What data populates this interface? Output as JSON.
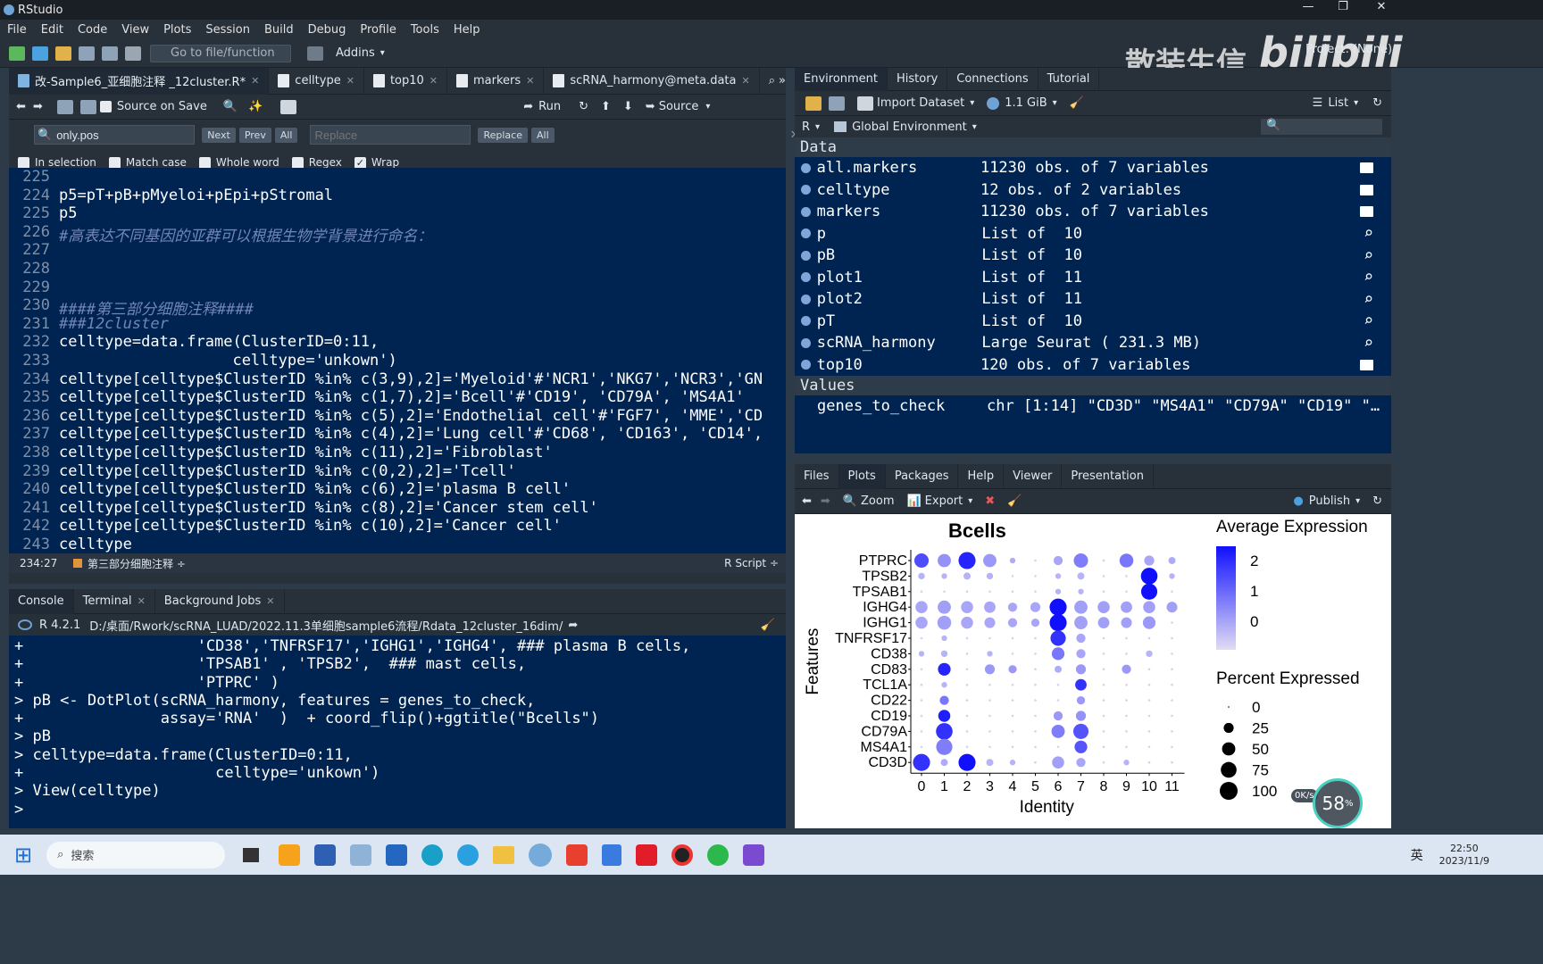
{
  "window": {
    "title": "RStudio"
  },
  "menu": [
    "File",
    "Edit",
    "Code",
    "View",
    "Plots",
    "Session",
    "Build",
    "Debug",
    "Profile",
    "Tools",
    "Help"
  ],
  "toolbar": {
    "goto_placeholder": "Go to file/function",
    "addins": "Addins",
    "project": "Project: (None)"
  },
  "watermark": {
    "text": "散装生信",
    "logo": "bilibili"
  },
  "editor": {
    "tabs": [
      {
        "label": "改-Sample6_亚细胞注释 _12cluster.R*",
        "active": true
      },
      {
        "label": "celltype",
        "active": false
      },
      {
        "label": "top10",
        "active": false
      },
      {
        "label": "markers",
        "active": false
      },
      {
        "label": "scRNA_harmony@meta.data",
        "active": false
      }
    ],
    "toolbar": {
      "source_on_save": "Source on Save",
      "run": "Run",
      "source": "Source"
    },
    "find": {
      "value": "only.pos",
      "next": "Next",
      "prev": "Prev",
      "all": "All",
      "replace_placeholder": "Replace",
      "replace": "Replace",
      "replace_all": "All"
    },
    "options": {
      "in_selection": "In selection",
      "match_case": "Match case",
      "whole_word": "Whole word",
      "regex": "Regex",
      "wrap": "Wrap"
    },
    "status": {
      "position": "234:27",
      "section": "第三部分细胞注释 ÷",
      "filetype": "R Script ÷"
    },
    "lines": [
      {
        "n": "225",
        "code": ""
      },
      {
        "n": "224",
        "code": "p5=pT+pB+pMyeloi+pEpi+pStromal"
      },
      {
        "n": "225",
        "code": "p5"
      },
      {
        "n": "226",
        "code": "#高表达不同基因的亚群可以根据生物学背景进行命名：",
        "comment": true
      },
      {
        "n": "227",
        "code": ""
      },
      {
        "n": "228",
        "code": ""
      },
      {
        "n": "229",
        "code": ""
      },
      {
        "n": "230",
        "code": "####第三部分细胞注释####",
        "comment": true
      },
      {
        "n": "231",
        "code": "###12cluster",
        "comment": true
      },
      {
        "n": "232",
        "code": "celltype=data.frame(ClusterID=0:11,"
      },
      {
        "n": "233",
        "code": "                   celltype='unkown')"
      },
      {
        "n": "234",
        "code": "celltype[celltype$ClusterID %in% c(3,9),2]='Myeloid'#'NCR1','NKG7','NCR3','GN"
      },
      {
        "n": "235",
        "code": "celltype[celltype$ClusterID %in% c(1,7),2]='Bcell'#'CD19', 'CD79A', 'MS4A1'"
      },
      {
        "n": "236",
        "code": "celltype[celltype$ClusterID %in% c(5),2]='Endothelial cell'#'FGF7', 'MME','CD"
      },
      {
        "n": "237",
        "code": "celltype[celltype$ClusterID %in% c(4),2]='Lung cell'#'CD68', 'CD163', 'CD14',"
      },
      {
        "n": "238",
        "code": "celltype[celltype$ClusterID %in% c(11),2]='Fibroblast'"
      },
      {
        "n": "239",
        "code": "celltype[celltype$ClusterID %in% c(0,2),2]='Tcell'"
      },
      {
        "n": "240",
        "code": "celltype[celltype$ClusterID %in% c(6),2]='plasma B cell'"
      },
      {
        "n": "241",
        "code": "celltype[celltype$ClusterID %in% c(8),2]='Cancer stem cell'"
      },
      {
        "n": "242",
        "code": "celltype[celltype$ClusterID %in% c(10),2]='Cancer cell'"
      },
      {
        "n": "243",
        "code": "celltype"
      },
      {
        "n": "244",
        "code": ""
      }
    ]
  },
  "console": {
    "tabs": [
      "Console",
      "Terminal",
      "Background Jobs"
    ],
    "r_version": "R 4.2.1",
    "path": "D:/桌面/Rwork/scRNA_LUAD/2022.11.3单细胞sample6流程/Rdata_12cluster_16dim/",
    "lines": [
      "+                   'CD38','TNFRSF17','IGHG1','IGHG4', ### plasma B cells,",
      "+                   'TPSAB1' , 'TPSB2',  ### mast cells,",
      "+                   'PTPRC' )",
      "> pB <- DotPlot(scRNA_harmony, features = genes_to_check,",
      "+               assay='RNA'  )  + coord_flip()+ggtitle(\"Bcells\")",
      "> pB",
      "> celltype=data.frame(ClusterID=0:11,",
      "+                     celltype='unkown')",
      "> View(celltype)",
      "> "
    ]
  },
  "environment": {
    "tabs": [
      "Environment",
      "History",
      "Connections",
      "Tutorial"
    ],
    "import_dataset": "Import Dataset",
    "memory": "1.1 GiB",
    "list_mode": "List",
    "language": "R",
    "scope": "Global Environment",
    "data_header": "Data",
    "values_header": "Values",
    "data": [
      {
        "name": "all.markers",
        "value": "11230 obs. of 7 variables",
        "icon": "table-icon"
      },
      {
        "name": "celltype",
        "value": "12 obs. of 2 variables",
        "icon": "table-icon"
      },
      {
        "name": "markers",
        "value": "11230 obs. of 7 variables",
        "icon": "table-icon"
      },
      {
        "name": "p",
        "value": "List of  10",
        "icon": "search-icon"
      },
      {
        "name": "pB",
        "value": "List of  10",
        "icon": "search-icon"
      },
      {
        "name": "plot1",
        "value": "List of  11",
        "icon": "search-icon"
      },
      {
        "name": "plot2",
        "value": "List of  11",
        "icon": "search-icon"
      },
      {
        "name": "pT",
        "value": "List of  10",
        "icon": "search-icon"
      },
      {
        "name": "scRNA_harmony",
        "value": "Large Seurat ( 231.3 MB)",
        "icon": "search-icon"
      },
      {
        "name": "top10",
        "value": "120 obs. of 7 variables",
        "icon": "table-icon"
      }
    ],
    "values": [
      {
        "name": "genes_to_check",
        "value": "chr [1:14] \"CD3D\" \"MS4A1\" \"CD79A\" \"CD19\" \"…"
      }
    ]
  },
  "plots": {
    "tabs": [
      "Files",
      "Plots",
      "Packages",
      "Help",
      "Viewer",
      "Presentation"
    ],
    "zoom": "Zoom",
    "export": "Export",
    "publish": "Publish"
  },
  "chart_data": {
    "type": "scatter",
    "title": "Bcells",
    "xlabel": "Identity",
    "ylabel": "Features",
    "x_categories": [
      "0",
      "1",
      "2",
      "3",
      "4",
      "5",
      "6",
      "7",
      "8",
      "9",
      "10",
      "11"
    ],
    "features": [
      "PTPRC",
      "TPSB2",
      "TPSAB1",
      "IGHG4",
      "IGHG1",
      "TNFRSF17",
      "CD38",
      "CD83",
      "TCL1A",
      "CD22",
      "CD19",
      "CD79A",
      "MS4A1",
      "CD3D"
    ],
    "legend_color_title": "Average Expression",
    "legend_color_ticks": [
      "2",
      "1",
      "0"
    ],
    "legend_color_range": [
      -0.5,
      2.5
    ],
    "legend_size_title": "Percent Expressed",
    "legend_size_ticks": [
      "0",
      "25",
      "50",
      "75",
      "100"
    ],
    "colors": {
      "low": "#e0dcf4",
      "high": "#1010ff"
    },
    "points": [
      [
        0,
        0,
        60,
        1.6
      ],
      [
        0,
        1,
        50,
        0.6
      ],
      [
        0,
        2,
        90,
        2.2
      ],
      [
        0,
        3,
        50,
        0.5
      ],
      [
        0,
        4,
        5,
        0.2
      ],
      [
        0,
        6,
        20,
        0.3
      ],
      [
        0,
        7,
        60,
        0.9
      ],
      [
        0,
        9,
        55,
        1.0
      ],
      [
        0,
        10,
        25,
        0.3
      ],
      [
        0,
        11,
        10,
        0.2
      ],
      [
        1,
        0,
        8,
        0.1
      ],
      [
        1,
        1,
        5,
        0.1
      ],
      [
        1,
        2,
        10,
        0.1
      ],
      [
        1,
        3,
        8,
        0.1
      ],
      [
        1,
        6,
        5,
        0.1
      ],
      [
        1,
        7,
        10,
        0.1
      ],
      [
        1,
        10,
        85,
        2.5
      ],
      [
        1,
        11,
        5,
        0.1
      ],
      [
        2,
        10,
        80,
        2.5
      ],
      [
        2,
        7,
        5,
        0.1
      ],
      [
        2,
        6,
        5,
        0.1
      ],
      [
        3,
        0,
        40,
        0.3
      ],
      [
        3,
        1,
        50,
        0.4
      ],
      [
        3,
        2,
        40,
        0.3
      ],
      [
        3,
        3,
        35,
        0.3
      ],
      [
        3,
        4,
        20,
        0.3
      ],
      [
        3,
        5,
        25,
        0.3
      ],
      [
        3,
        6,
        90,
        2.5
      ],
      [
        3,
        7,
        50,
        0.4
      ],
      [
        3,
        8,
        40,
        0.4
      ],
      [
        3,
        9,
        35,
        0.4
      ],
      [
        3,
        10,
        40,
        0.4
      ],
      [
        3,
        11,
        30,
        0.4
      ],
      [
        4,
        0,
        40,
        0.3
      ],
      [
        4,
        1,
        55,
        0.4
      ],
      [
        4,
        2,
        40,
        0.3
      ],
      [
        4,
        3,
        30,
        0.3
      ],
      [
        4,
        4,
        20,
        0.3
      ],
      [
        4,
        5,
        15,
        0.3
      ],
      [
        4,
        6,
        90,
        2.5
      ],
      [
        4,
        7,
        50,
        0.4
      ],
      [
        4,
        8,
        35,
        0.4
      ],
      [
        4,
        9,
        30,
        0.4
      ],
      [
        4,
        10,
        45,
        0.5
      ],
      [
        5,
        1,
        5,
        0.1
      ],
      [
        5,
        6,
        70,
        2.0
      ],
      [
        5,
        7,
        20,
        0.3
      ],
      [
        6,
        0,
        5,
        0.1
      ],
      [
        6,
        1,
        8,
        0.1
      ],
      [
        6,
        3,
        5,
        0.1
      ],
      [
        6,
        6,
        45,
        1.0
      ],
      [
        6,
        7,
        20,
        0.3
      ],
      [
        6,
        10,
        8,
        0.1
      ],
      [
        7,
        1,
        45,
        2.2
      ],
      [
        7,
        3,
        25,
        0.5
      ],
      [
        7,
        4,
        15,
        0.5
      ],
      [
        7,
        6,
        10,
        0.2
      ],
      [
        7,
        7,
        25,
        0.5
      ],
      [
        7,
        9,
        20,
        0.5
      ],
      [
        8,
        1,
        5,
        0.1
      ],
      [
        8,
        7,
        35,
        2.0
      ],
      [
        9,
        1,
        20,
        1.0
      ],
      [
        9,
        7,
        15,
        0.5
      ],
      [
        10,
        1,
        40,
        2.3
      ],
      [
        10,
        6,
        20,
        0.5
      ],
      [
        10,
        7,
        25,
        0.6
      ],
      [
        11,
        1,
        85,
        2.0
      ],
      [
        11,
        6,
        50,
        0.9
      ],
      [
        11,
        7,
        70,
        1.5
      ],
      [
        12,
        1,
        80,
        0.9
      ],
      [
        12,
        7,
        45,
        1.5
      ],
      [
        13,
        0,
        90,
        2.0
      ],
      [
        13,
        1,
        10,
        0.2
      ],
      [
        13,
        2,
        90,
        2.5
      ],
      [
        13,
        3,
        10,
        0.1
      ],
      [
        13,
        4,
        5,
        0.1
      ],
      [
        13,
        6,
        40,
        0.4
      ],
      [
        13,
        7,
        20,
        0.3
      ],
      [
        13,
        9,
        5,
        0.1
      ]
    ]
  },
  "overlay": {
    "speed": "0K/s",
    "percent": "58",
    "percent_unit": "%"
  },
  "taskbar": {
    "search_placeholder": "搜索",
    "time": "22:50",
    "date": "2023/11/9",
    "ime": "英"
  }
}
